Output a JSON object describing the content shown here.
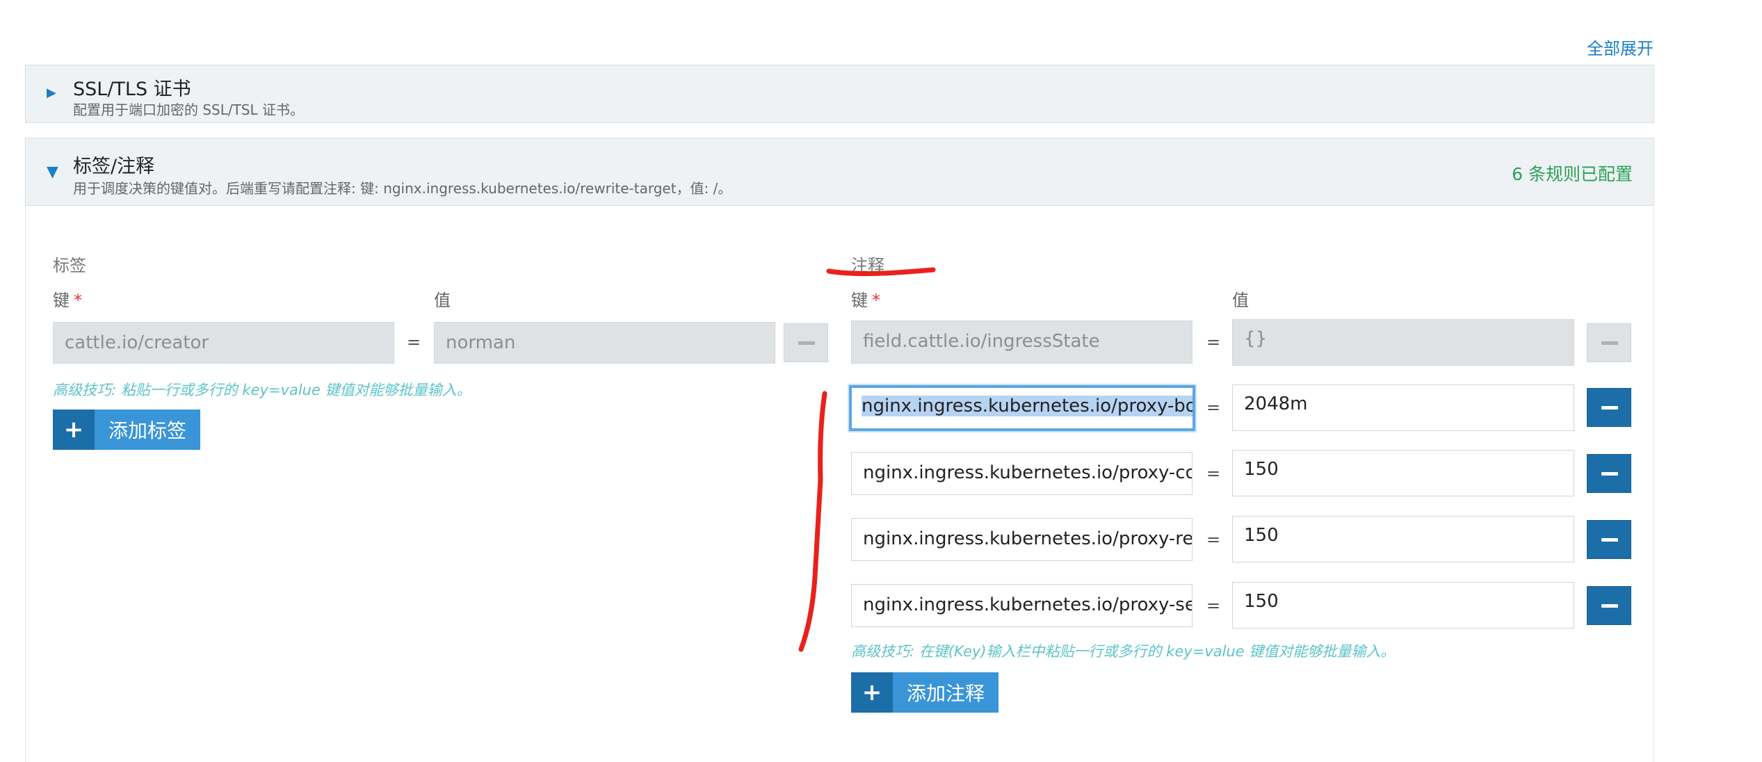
{
  "header": {
    "expand_all": "全部展开"
  },
  "ssl_section": {
    "title": "SSL/TLS 证书",
    "description": "配置用于端口加密的 SSL/TSL 证书。"
  },
  "labels_section": {
    "title": "标签/注释",
    "description": "用于调度决策的键值对。后端重写请配置注释: 键: nginx.ingress.kubernetes.io/rewrite-target，值: /。",
    "status": "6 条规则已配置"
  },
  "labels": {
    "title": "标签",
    "key_label": "键",
    "value_label": "值",
    "required_mark": "*",
    "rows": [
      {
        "key": "cattle.io/creator",
        "value": "norman"
      }
    ],
    "hint": "高级技巧: 粘贴一行或多行的 key=value 键值对能够批量输入。",
    "add_button": "添加标签"
  },
  "annotations": {
    "title": "注释",
    "key_label": "键",
    "value_label": "值",
    "required_mark": "*",
    "rows": [
      {
        "key": "field.cattle.io/ingressState",
        "value": "{}"
      },
      {
        "key": "nginx.ingress.kubernetes.io/proxy-body",
        "value": "2048m"
      },
      {
        "key": "nginx.ingress.kubernetes.io/proxy-conr",
        "value": "150"
      },
      {
        "key": "nginx.ingress.kubernetes.io/proxy-read",
        "value": "150"
      },
      {
        "key": "nginx.ingress.kubernetes.io/proxy-senc",
        "value": "150"
      }
    ],
    "hint": "高级技巧: 在键(Key)输入栏中粘贴一行或多行的 key=value 键值对能够批量输入。",
    "add_button": "添加注释"
  },
  "equals_sign": "=",
  "icons": {
    "plus": "+",
    "expanded_arrow": "▼",
    "collapsed_arrow": "▶"
  },
  "colors": {
    "accent": "#1c6ea8",
    "success": "#2aa156",
    "hint": "#5cc3c8",
    "annotation": "#e8211c"
  }
}
